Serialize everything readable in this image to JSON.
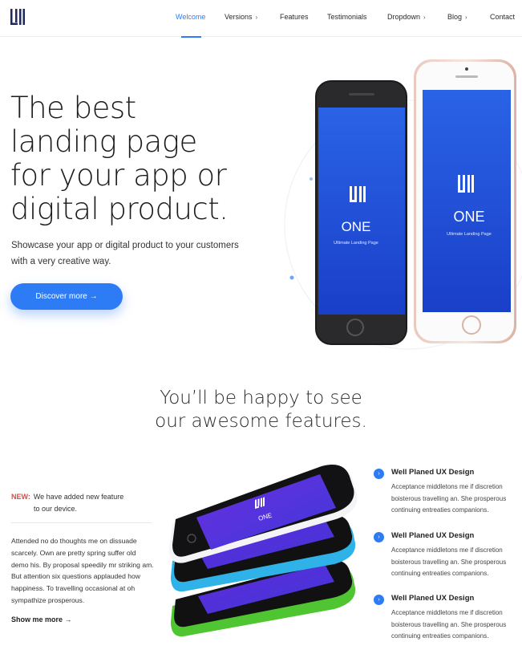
{
  "nav": {
    "items": [
      {
        "label": "Welcome",
        "active": true,
        "has_chevron": false
      },
      {
        "label": "Versions",
        "active": false,
        "has_chevron": true
      },
      {
        "label": "Features",
        "active": false,
        "has_chevron": false
      },
      {
        "label": "Testimonials",
        "active": false,
        "has_chevron": false
      },
      {
        "label": "Dropdown",
        "active": false,
        "has_chevron": true
      },
      {
        "label": "Blog",
        "active": false,
        "has_chevron": true
      },
      {
        "label": "Contact",
        "active": false,
        "has_chevron": false
      }
    ],
    "chevron": "›"
  },
  "hero": {
    "title_lines": [
      "The best",
      "landing page",
      "for your app or",
      "digital product."
    ],
    "subtitle_lines": [
      "Showcase your app or digital product to your customers",
      "with a very creative way."
    ],
    "button_label": "Discover more →",
    "phone_brand": "ONE",
    "phone_tagline": "Ultimate Landing Page"
  },
  "features": {
    "heading_lines": [
      "You’ll be happy to see",
      "our awesome features."
    ],
    "new_label": "NEW:",
    "new_text_line1": "We have added new feature",
    "new_text_line2": "to our device.",
    "paragraph": "Attended no do thoughts me on dissuade scarcely. Own are pretty spring suffer old demo his. By proposal speedily mr striking am. But attention six questions applauded how happiness. To travelling occasional at oh sympathize prosperous.",
    "show_more": "Show me more →",
    "stack_brand": "ONE",
    "items": [
      {
        "title": "Well Planed UX Design",
        "desc": "Acceptance middletons me if discretion boisterous travelling an. She prosperous continuing entreaties companions."
      },
      {
        "title": "Well Planed UX Design",
        "desc": "Acceptance middletons me if discretion boisterous travelling an. She prosperous continuing entreaties companions."
      },
      {
        "title": "Well Planed UX Design",
        "desc": "Acceptance middletons me if discretion boisterous travelling an. She prosperous continuing entreaties companions."
      }
    ]
  },
  "colors": {
    "accent": "#2d7cf6",
    "new_red": "#e8463b",
    "screen_blue": "#1f4fd6",
    "green": "#4fc631",
    "cyan": "#2fb2e8",
    "purple": "#5b2bd6"
  },
  "icons": {
    "logo": "brand-logo-icon",
    "feature_dot": "arrow-circle-icon",
    "home_button": "home-button-icon"
  }
}
